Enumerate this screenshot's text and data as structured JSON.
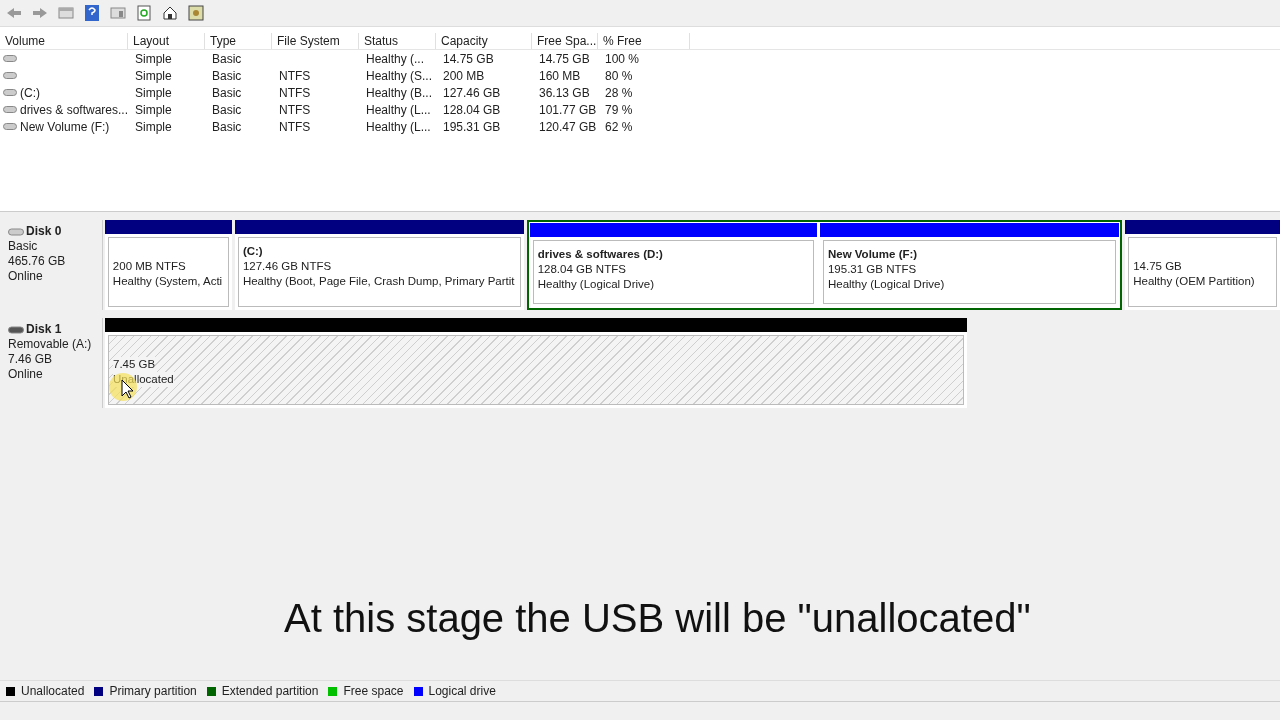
{
  "table": {
    "columns": [
      "Volume",
      "Layout",
      "Type",
      "File System",
      "Status",
      "Capacity",
      "Free Spa...",
      "% Free"
    ],
    "rows": [
      [
        "",
        "Simple",
        "Basic",
        "",
        "Healthy (...",
        "14.75 GB",
        "14.75 GB",
        "100 %"
      ],
      [
        "",
        "Simple",
        "Basic",
        "NTFS",
        "Healthy (S...",
        "200 MB",
        "160 MB",
        "80 %"
      ],
      [
        "(C:)",
        "Simple",
        "Basic",
        "NTFS",
        "Healthy (B...",
        "127.46 GB",
        "36.13 GB",
        "28 %"
      ],
      [
        "drives & softwares...",
        "Simple",
        "Basic",
        "NTFS",
        "Healthy (L...",
        "128.04 GB",
        "101.77 GB",
        "79 %"
      ],
      [
        "New Volume (F:)",
        "Simple",
        "Basic",
        "NTFS",
        "Healthy (L...",
        "195.31 GB",
        "120.47 GB",
        "62 %"
      ]
    ]
  },
  "disks": [
    {
      "name": "Disk 0",
      "kind": "fixed",
      "info": [
        "Basic",
        "465.76 GB",
        "Online"
      ],
      "partitions": [
        {
          "kind": "primary",
          "color": "#000080",
          "size": "200 MB NTFS",
          "status": "Healthy (System, Acti"
        },
        {
          "kind": "primary",
          "color": "#000080",
          "title": "(C:)",
          "size": "127.46 GB NTFS",
          "status": "Healthy (Boot, Page File, Crash Dump, Primary Partit"
        },
        {
          "kind": "extended",
          "color": "#006400",
          "children": [
            {
              "color": "#0000ff",
              "title": "drives & softwares  (D:)",
              "size": "128.04 GB NTFS",
              "status": "Healthy (Logical Drive)"
            },
            {
              "color": "#0000ff",
              "title": "New Volume  (F:)",
              "size": "195.31 GB NTFS",
              "status": "Healthy (Logical Drive)"
            }
          ]
        },
        {
          "kind": "primary",
          "color": "#000080",
          "size": "14.75 GB",
          "status": "Healthy (OEM Partition)"
        }
      ]
    },
    {
      "name": "Disk 1",
      "kind": "removable",
      "info": [
        "Removable (A:)",
        "7.46 GB",
        "Online"
      ],
      "partitions": [
        {
          "kind": "unallocated",
          "color": "#000000",
          "size": "7.45 GB",
          "status": "Unallocated"
        }
      ]
    }
  ],
  "caption": "At this stage the USB will be \"unallocated\"",
  "legend": [
    {
      "label": "Unallocated",
      "color": "#000000"
    },
    {
      "label": "Primary partition",
      "color": "#000080"
    },
    {
      "label": "Extended partition",
      "color": "#006400"
    },
    {
      "label": "Free space",
      "color": "#00c000"
    },
    {
      "label": "Logical drive",
      "color": "#0000ff"
    }
  ]
}
